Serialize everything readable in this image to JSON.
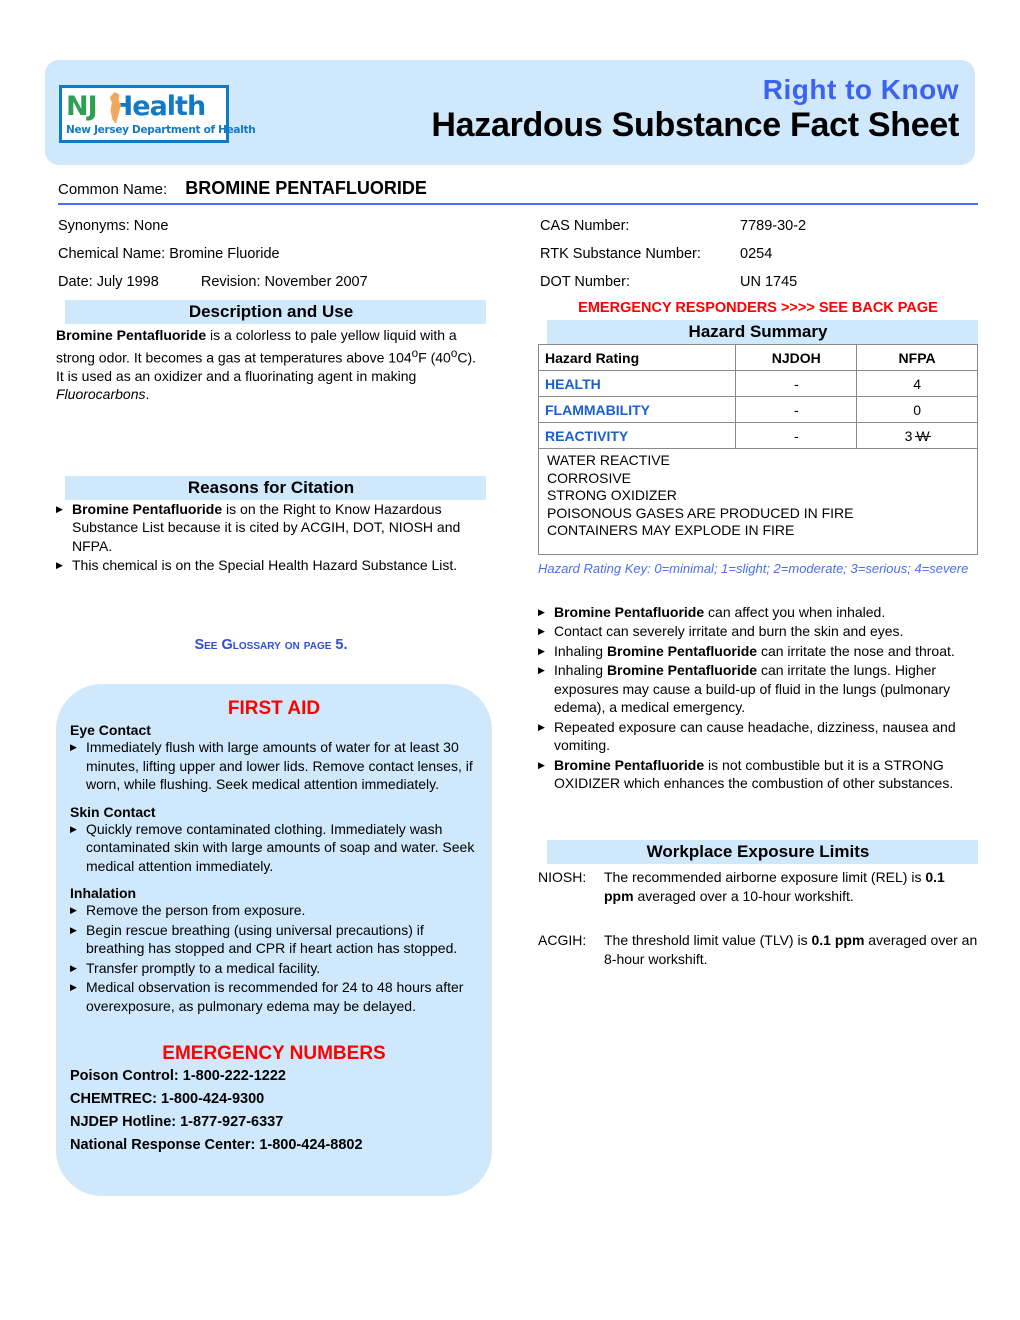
{
  "header": {
    "logo": {
      "nj": "NJ",
      "health": "Health",
      "tagline": "New Jersey Department of Health",
      "state_shape": "nj-state-outline"
    },
    "right_to_know": "Right to Know",
    "sheet_title": "Hazardous Substance Fact Sheet",
    "banner_color": "#cfe8fb",
    "rtk_color": "#3c63f0"
  },
  "identification": {
    "common_name_label": "Common Name:",
    "common_name_value": "BROMINE PENTAFLUORIDE",
    "synonyms_label": "Synonyms:",
    "synonyms_value": "None",
    "chemical_name_label": "Chemical Name:",
    "chemical_name_value": "Bromine Fluoride",
    "date_label": "Date:",
    "date_value": "July 1998",
    "revision_label": "Revision:",
    "revision_value": "November 2007",
    "cas_label": "CAS Number:",
    "cas_value": "7789-30-2",
    "rtk_label": "RTK Substance Number:",
    "rtk_value": "0254",
    "dot_label": "DOT Number:",
    "dot_value": "UN 1745"
  },
  "description": {
    "heading": "Description and Use",
    "p1_bold": "Bromine Pentafluoride",
    "p1_rest_a": " is a colorless to pale yellow liquid with a strong odor.  It becomes a gas at temperatures above 104",
    "p1_deg_f": "o",
    "p1_f": "F (40",
    "p1_deg_c": "o",
    "p1_rest_b": "C).  It is used as an oxidizer and a fluorinating agent in making ",
    "p1_italic": "Fluorocarbons",
    "p1_end": "."
  },
  "reasons": {
    "heading": "Reasons for Citation",
    "items": [
      {
        "bold": "Bromine Pentafluoride",
        "text": " is on the Right to Know Hazardous Substance List because it is cited by ACGIH, DOT, NIOSH and NFPA."
      },
      {
        "bold": "",
        "text": "This chemical is on the Special Health Hazard Substance List."
      }
    ]
  },
  "glossary_note": "See Glossary on page 5.",
  "emergency_responders_note": "EMERGENCY RESPONDERS >>>> SEE BACK PAGE",
  "hazard_summary": {
    "heading": "Hazard Summary",
    "columns": [
      "Hazard Rating",
      "NJDOH",
      "NFPA"
    ],
    "rows": [
      {
        "category": "HEALTH",
        "njdoh": "-",
        "nfpa": "4",
        "nfpa_special": ""
      },
      {
        "category": "FLAMMABILITY",
        "njdoh": "-",
        "nfpa": "0",
        "nfpa_special": ""
      },
      {
        "category": "REACTIVITY",
        "njdoh": "-",
        "nfpa": "3",
        "nfpa_special": "W"
      }
    ],
    "notes": [
      "WATER REACTIVE",
      "CORROSIVE",
      "STRONG OXIDIZER",
      "POISONOUS GASES ARE PRODUCED IN FIRE",
      "CONTAINERS MAY EXPLODE IN FIRE"
    ],
    "rating_key": "Hazard Rating Key: 0=minimal; 1=slight; 2=moderate; 3=serious; 4=severe"
  },
  "health_effects": [
    {
      "bold_lead": "Bromine Pentafluoride",
      "text": " can affect you when inhaled."
    },
    {
      "bold_lead": "",
      "text": "Contact can severely irritate and burn the skin and eyes."
    },
    {
      "bold_lead": "",
      "prefix": "Inhaling ",
      "mid_bold": "Bromine Pentafluoride",
      "text": " can irritate the nose and throat."
    },
    {
      "bold_lead": "",
      "prefix": "Inhaling ",
      "mid_bold": "Bromine Pentafluoride",
      "text": " can irritate the lungs.  Higher exposures may cause a build-up of fluid in the lungs (pulmonary edema), a medical emergency."
    },
    {
      "bold_lead": "",
      "text": "Repeated exposure can cause headache, dizziness, nausea and vomiting."
    },
    {
      "bold_lead": "Bromine Pentafluoride",
      "text": " is not combustible but it is a STRONG OXIDIZER which enhances the combustion of other substances."
    }
  ],
  "first_aid": {
    "title": "FIRST AID",
    "sections": [
      {
        "subhead": "Eye Contact",
        "items": [
          "Immediately flush with large amounts of water for at least 30 minutes, lifting upper and lower lids.  Remove contact lenses, if worn, while flushing.  Seek medical attention immediately."
        ]
      },
      {
        "subhead": "Skin Contact",
        "items": [
          "Quickly remove contaminated clothing.  Immediately wash contaminated skin with large amounts of soap and water.  Seek medical attention immediately."
        ]
      },
      {
        "subhead": "Inhalation",
        "items": [
          "Remove the person from exposure.",
          "Begin rescue breathing (using universal precautions) if breathing has stopped and CPR if heart action has stopped.",
          "Transfer promptly to a medical facility.",
          "Medical observation is recommended for 24 to 48 hours after overexposure, as pulmonary edema may be delayed."
        ]
      }
    ],
    "emergency_numbers_title": "EMERGENCY NUMBERS",
    "emergency_numbers": [
      "Poison Control:  1-800-222-1222",
      "CHEMTREC:  1-800-424-9300",
      "NJDEP Hotline:  1-877-927-6337",
      "National Response Center:  1-800-424-8802"
    ]
  },
  "workplace_exposure": {
    "heading": "Workplace Exposure Limits",
    "entries": [
      {
        "agency": "NIOSH:",
        "text_a": "The recommended airborne exposure limit (REL) is ",
        "bold": "0.1 ppm",
        "text_b": " averaged over a 10-hour workshift."
      },
      {
        "agency": "ACGIH:",
        "text_a": "The threshold limit value (TLV) is ",
        "bold": "0.1 ppm",
        "text_b": " averaged over an 8-hour workshift."
      }
    ]
  }
}
